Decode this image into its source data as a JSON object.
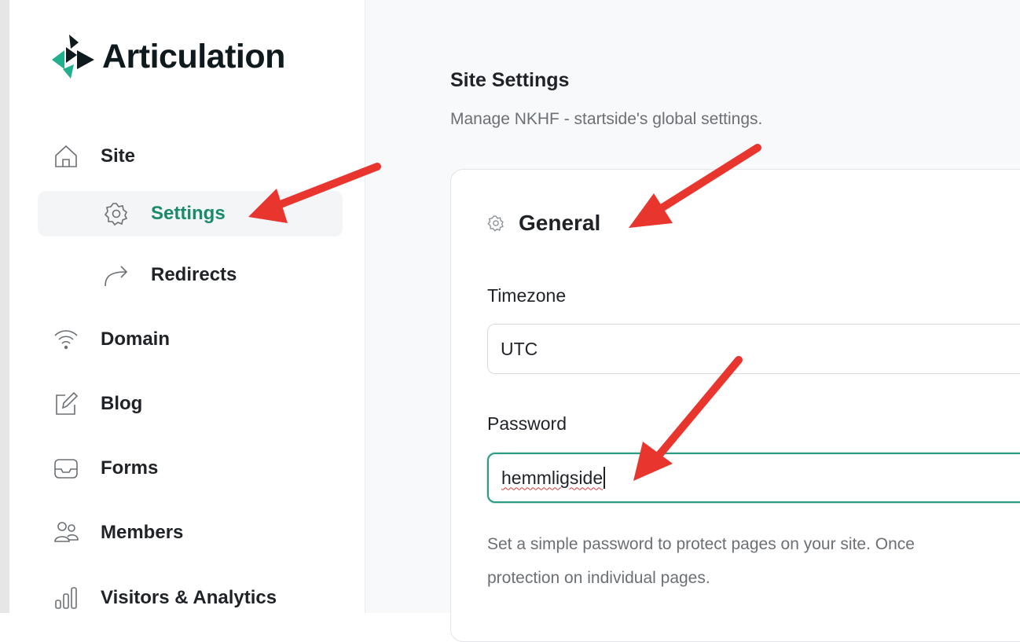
{
  "brand": {
    "name": "Articulation",
    "colors": {
      "accent": "#1a8a6e",
      "logo_dark": "#0f1a1e",
      "logo_green": "#20b08c",
      "annotation_arrow": "#e8362f"
    }
  },
  "sidebar": {
    "items": [
      {
        "label": "Site",
        "icon": "home-icon"
      },
      {
        "label": "Settings",
        "icon": "gear-icon",
        "active": true
      },
      {
        "label": "Redirects",
        "icon": "redirect-arrow-icon"
      },
      {
        "label": "Domain",
        "icon": "wifi-icon"
      },
      {
        "label": "Blog",
        "icon": "edit-icon"
      },
      {
        "label": "Forms",
        "icon": "inbox-icon"
      },
      {
        "label": "Members",
        "icon": "users-icon"
      },
      {
        "label": "Visitors & Analytics",
        "icon": "bar-chart-icon"
      }
    ]
  },
  "main": {
    "title": "Site Settings",
    "subtitle": "Manage NKHF - startside's global settings.",
    "card": {
      "title": "General",
      "timezone": {
        "label": "Timezone",
        "value": "UTC"
      },
      "password": {
        "label": "Password",
        "value": "hemmligside"
      },
      "help_line1": "Set a simple password to protect pages on your site. Once",
      "help_line2": "protection on individual pages."
    }
  }
}
